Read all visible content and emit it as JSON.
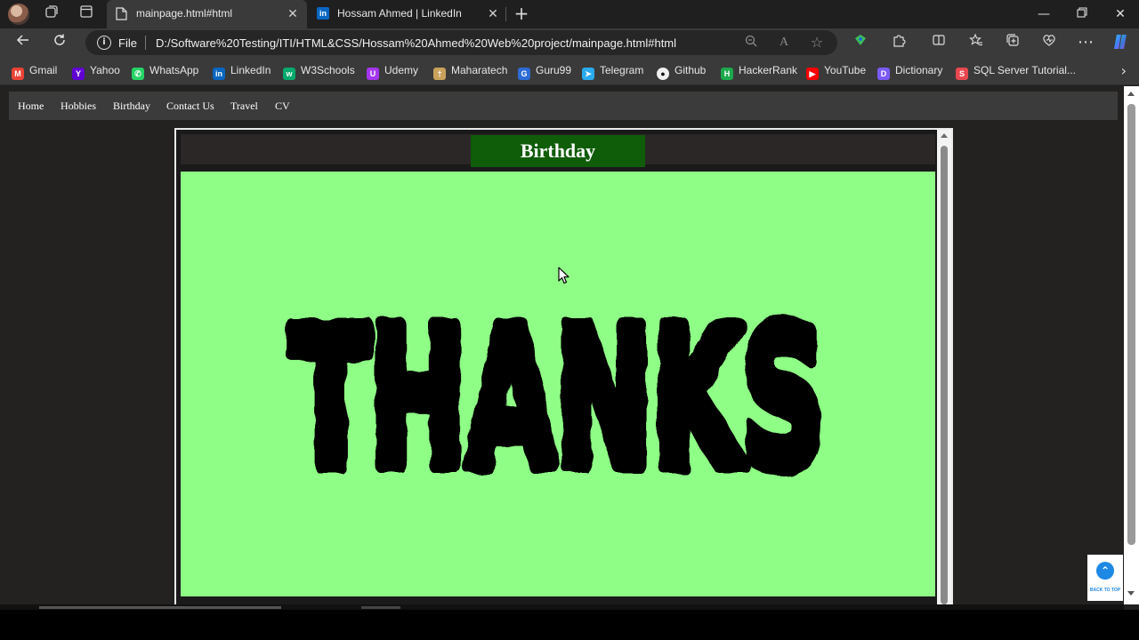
{
  "tabs": [
    {
      "title": "mainpage.html#html",
      "active": true
    },
    {
      "title": "Hossam Ahmed | LinkedIn",
      "active": false
    }
  ],
  "address": {
    "scheme_label": "File",
    "url": "D:/Software%20Testing/ITI/HTML&CSS/Hossam%20Ahmed%20Web%20project/mainpage.html#html"
  },
  "bookmarks": [
    {
      "label": "Gmail",
      "icon": "gmail-icon",
      "color": "#ea4335"
    },
    {
      "label": "Yahoo",
      "icon": "yahoo-icon",
      "color": "#6001d2"
    },
    {
      "label": "WhatsApp",
      "icon": "whatsapp-icon",
      "color": "#25d366"
    },
    {
      "label": "LinkedIn",
      "icon": "linkedin-icon",
      "color": "#0a66c2"
    },
    {
      "label": "W3Schools",
      "icon": "w3schools-icon",
      "color": "#04aa6d"
    },
    {
      "label": "Udemy",
      "icon": "udemy-icon",
      "color": "#a435f0"
    },
    {
      "label": "Maharatech",
      "icon": "maharatech-icon",
      "color": "#c9a15b"
    },
    {
      "label": "Guru99",
      "icon": "guru99-icon",
      "color": "#2d6bd6"
    },
    {
      "label": "Telegram",
      "icon": "telegram-icon",
      "color": "#2aabee"
    },
    {
      "label": "Github",
      "icon": "github-icon",
      "color": "#f0f0f0"
    },
    {
      "label": "HackerRank",
      "icon": "hackerrank-icon",
      "color": "#1ba94c"
    },
    {
      "label": "YouTube",
      "icon": "youtube-icon",
      "color": "#ff0000"
    },
    {
      "label": "Dictionary",
      "icon": "dictionary-icon",
      "color": "#7a5af8"
    },
    {
      "label": "SQL Server Tutorial...",
      "icon": "sqlserver-icon",
      "color": "#e8474f"
    }
  ],
  "site_nav": [
    "Home",
    "Hobbies",
    "Birthday",
    "Contact Us",
    "Travel",
    "CV"
  ],
  "section": {
    "title": "Birthday",
    "image_text": "THANKS",
    "panel_color": "#8ffe86",
    "title_bg": "#0f5c09"
  },
  "back_to_top": {
    "label": "BACK TO TOP"
  }
}
